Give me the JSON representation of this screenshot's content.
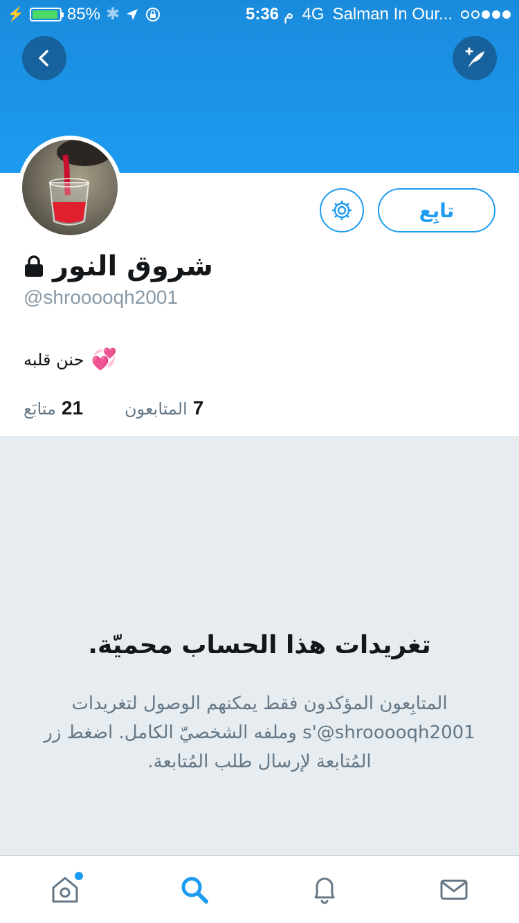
{
  "status_bar": {
    "battery_percent": "85%",
    "time": "5:36",
    "time_suffix": "م",
    "network": "4G",
    "carrier": "Salman In Our...",
    "signal_bars_filled": 3,
    "signal_bars_total": 5
  },
  "profile": {
    "display_name": "شروق النور",
    "handle": "@shrooooqh2001",
    "bio_text": "حنن قلبه",
    "bio_emoji": "💞",
    "follow_label": "تابِع",
    "following_count": "21",
    "following_label": "متابَع",
    "followers_count": "7",
    "followers_label": "المتابعون"
  },
  "protected": {
    "title": "تغريدات هذا الحساب محميّة.",
    "body": "المتابِعون المؤكدون فقط يمكنهم الوصول لتغريدات ‎@shrooooqh2001‏'s وملفه الشخصيّ الكامل. اضغط زر المُتابعة لإرسال طلب المُتابعة."
  },
  "colors": {
    "accent": "#1d9bf0",
    "header": "#1a8bdc",
    "background_muted": "#e6ecf0",
    "text_primary": "#14171a",
    "text_secondary": "#657786"
  },
  "icons": {
    "back": "chevron-left-icon",
    "compose": "compose-feather-icon",
    "settings": "gear-icon",
    "lock": "lock-icon",
    "home": "home-icon",
    "search": "search-icon",
    "notifications": "bell-icon",
    "messages": "mail-icon"
  },
  "tabs": [
    {
      "name": "home",
      "active": false,
      "has_badge": true
    },
    {
      "name": "search",
      "active": true,
      "has_badge": false
    },
    {
      "name": "notifications",
      "active": false,
      "has_badge": false
    },
    {
      "name": "messages",
      "active": false,
      "has_badge": false
    }
  ]
}
